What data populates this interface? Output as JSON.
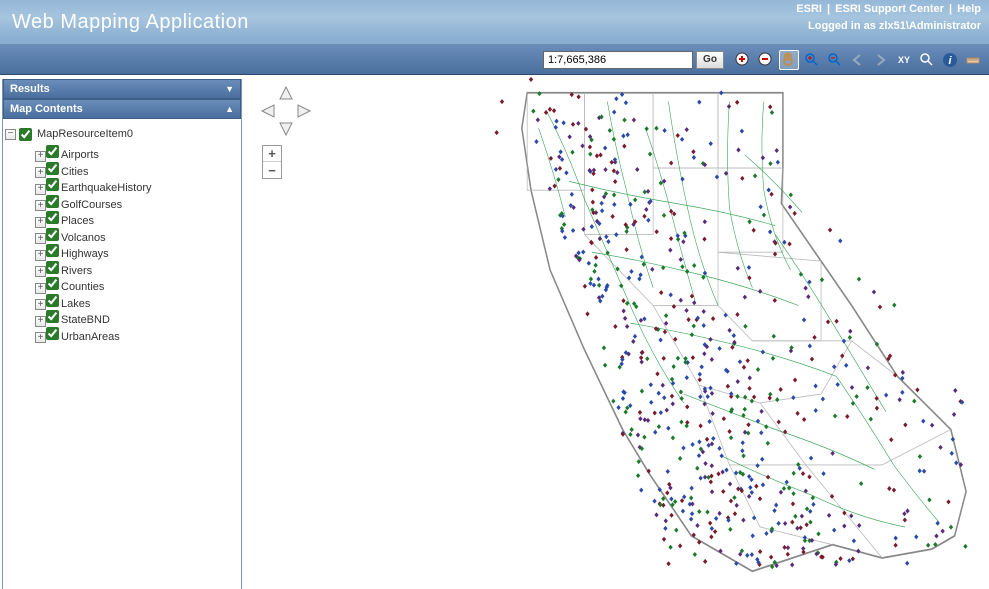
{
  "header": {
    "title": "Web Mapping Application",
    "links": [
      "ESRI",
      "ESRI Support Center",
      "Help"
    ],
    "login": "Logged in as zlx51\\Administrator"
  },
  "toolbar": {
    "scale": "1:7,665,386",
    "go": "Go"
  },
  "panels": {
    "results": "Results",
    "contents": "Map Contents"
  },
  "tree": {
    "root": "MapResourceItem0",
    "layers": [
      {
        "label": "Airports"
      },
      {
        "label": "Cities"
      },
      {
        "label": "EarthquakeHistory"
      },
      {
        "label": "GolfCourses"
      },
      {
        "label": "Places"
      },
      {
        "label": "Volcanos"
      },
      {
        "label": "Highways"
      },
      {
        "label": "Rivers"
      },
      {
        "label": "Counties"
      },
      {
        "label": "Lakes"
      },
      {
        "label": "StateBND"
      },
      {
        "label": "UrbanAreas"
      }
    ]
  }
}
